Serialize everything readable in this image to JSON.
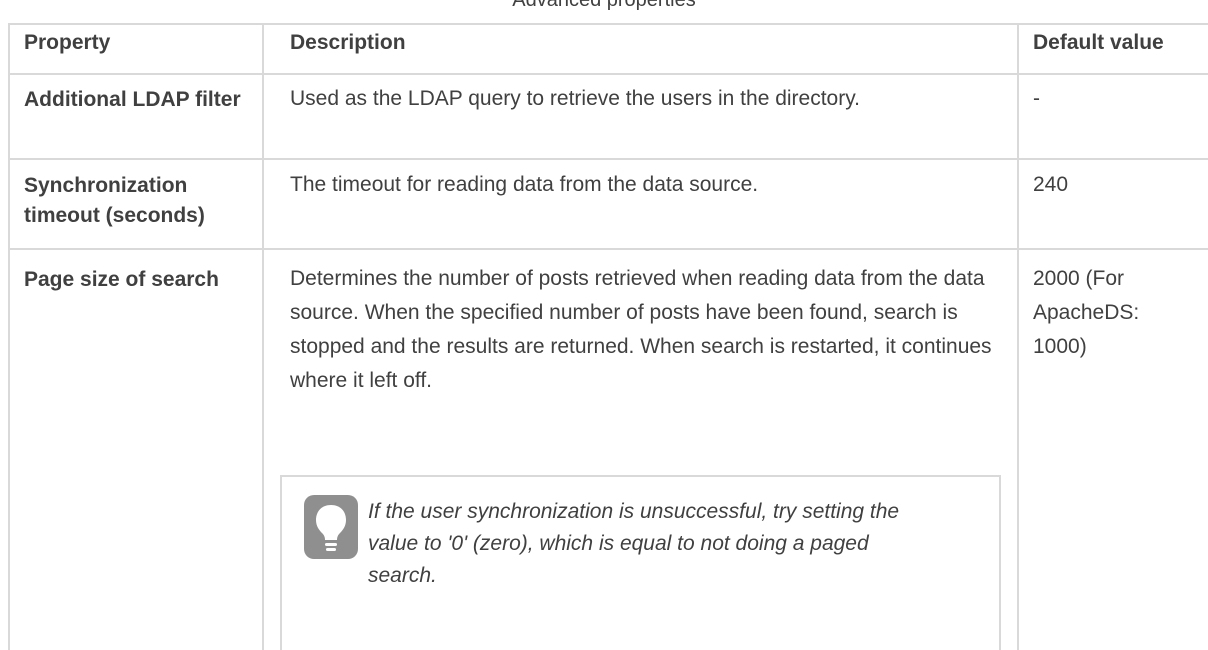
{
  "caption": "Advanced properties",
  "table": {
    "headers": {
      "property": "Property",
      "description": "Description",
      "default": "Default value"
    },
    "rows": [
      {
        "property": "Additional LDAP filter",
        "description": "Used as the LDAP query to retrieve the users in the directory.",
        "default": "-"
      },
      {
        "property": "Synchronization timeout (seconds)",
        "description": "The timeout for reading data from the data source.",
        "default": "240"
      },
      {
        "property": "Page size of search",
        "description": "Determines the number of posts retrieved when reading data from the data source. When the specified number of posts have been found, search is stopped and the results are returned. When search is restarted, it continues where it left off.",
        "default": "2000 (For ApacheDS: 1000)",
        "note": {
          "icon": "lightbulb-icon",
          "text": "If the user synchronization is unsuccessful, try setting the value to '0' (zero), which is equal to not doing a paged search."
        }
      }
    ]
  }
}
